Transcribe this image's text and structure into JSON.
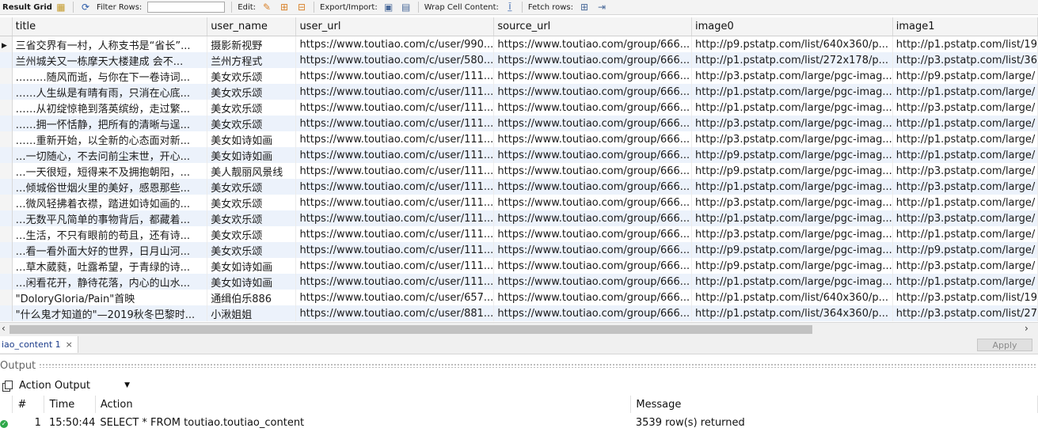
{
  "toolbar": {
    "result_grid": "Result Grid",
    "filter_rows": "Filter Rows:",
    "edit": "Edit:",
    "export_import": "Export/Import:",
    "wrap_cell": "Wrap Cell Content:",
    "fetch_rows": "Fetch rows:"
  },
  "grid": {
    "columns": [
      "title",
      "user_name",
      "user_url",
      "source_url",
      "image0",
      "image1"
    ],
    "rows": [
      [
        "三省交界有一村，人称支书是“省长”...",
        "摄影新视野",
        "https://www.toutiao.com/c/user/990...",
        "https://www.toutiao.com/group/666...",
        "http://p9.pstatp.com/list/640x360/p...",
        "http://p1.pstatp.com/list/19"
      ],
      [
        "兰州城关又一栋摩天大楼建成 会不...",
        "兰州方程式",
        "https://www.toutiao.com/c/user/580...",
        "https://www.toutiao.com/group/666...",
        "http://p1.pstatp.com/list/272x178/p...",
        "http://p3.pstatp.com/list/36"
      ],
      [
        "………随风而逝，与你在下一卷诗词...",
        "美女欢乐颂",
        "https://www.toutiao.com/c/user/111...",
        "https://www.toutiao.com/group/666...",
        "http://p3.pstatp.com/large/pgc-imag...",
        "http://p9.pstatp.com/large/"
      ],
      [
        "……人生纵是有晴有雨，只消在心底...",
        "美女欢乐颂",
        "https://www.toutiao.com/c/user/111...",
        "https://www.toutiao.com/group/666...",
        "http://p1.pstatp.com/large/pgc-imag...",
        "http://p1.pstatp.com/large/"
      ],
      [
        "……从初绽惊艳到落英缤纷，走过繁...",
        "美女欢乐颂",
        "https://www.toutiao.com/c/user/111...",
        "https://www.toutiao.com/group/666...",
        "http://p1.pstatp.com/large/pgc-imag...",
        "http://p3.pstatp.com/large/"
      ],
      [
        "……拥一怀恬静，把所有的清晰与逞...",
        "美女欢乐颂",
        "https://www.toutiao.com/c/user/111...",
        "https://www.toutiao.com/group/666...",
        "http://p3.pstatp.com/large/pgc-imag...",
        "http://p1.pstatp.com/large/"
      ],
      [
        "……重新开始，以全新的心态面对新...",
        "美女如诗如画",
        "https://www.toutiao.com/c/user/111...",
        "https://www.toutiao.com/group/666...",
        "http://p3.pstatp.com/large/pgc-imag...",
        "http://p1.pstatp.com/large/"
      ],
      [
        "…一切随心，不去问前尘末世，开心...",
        "美女如诗如画",
        "https://www.toutiao.com/c/user/111...",
        "https://www.toutiao.com/group/666...",
        "http://p9.pstatp.com/large/pgc-imag...",
        "http://p1.pstatp.com/large/"
      ],
      [
        "…一天很短，短得来不及拥抱朝阳，...",
        "美人靓丽风景线",
        "https://www.toutiao.com/c/user/111...",
        "https://www.toutiao.com/group/666...",
        "http://p9.pstatp.com/large/pgc-imag...",
        "http://p3.pstatp.com/large/"
      ],
      [
        "…倾城俗世烟火里的美好，感恩那些...",
        "美女欢乐颂",
        "https://www.toutiao.com/c/user/111...",
        "https://www.toutiao.com/group/666...",
        "http://p1.pstatp.com/large/pgc-imag...",
        "http://p3.pstatp.com/large/"
      ],
      [
        "…微风轻拂着衣襟，踏进如诗如画的...",
        "美女欢乐颂",
        "https://www.toutiao.com/c/user/111...",
        "https://www.toutiao.com/group/666...",
        "http://p3.pstatp.com/large/pgc-imag...",
        "http://p1.pstatp.com/large/"
      ],
      [
        "…无数平凡简单的事物背后，都藏着...",
        "美女欢乐颂",
        "https://www.toutiao.com/c/user/111...",
        "https://www.toutiao.com/group/666...",
        "http://p1.pstatp.com/large/pgc-imag...",
        "http://p3.pstatp.com/large/"
      ],
      [
        "…生活，不只有眼前的苟且，还有诗...",
        "美女欢乐颂",
        "https://www.toutiao.com/c/user/111...",
        "https://www.toutiao.com/group/666...",
        "http://p3.pstatp.com/large/pgc-imag...",
        "http://p1.pstatp.com/large/"
      ],
      [
        "…看一看外面大好的世界，日月山河...",
        "美女欢乐颂",
        "https://www.toutiao.com/c/user/111...",
        "https://www.toutiao.com/group/666...",
        "http://p9.pstatp.com/large/pgc-imag...",
        "http://p9.pstatp.com/large/"
      ],
      [
        "…草木葳蕤，吐露希望，于青绿的诗...",
        "美女如诗如画",
        "https://www.toutiao.com/c/user/111...",
        "https://www.toutiao.com/group/666...",
        "http://p9.pstatp.com/large/pgc-imag...",
        "http://p3.pstatp.com/large/"
      ],
      [
        "…闲看花开，静待花落，内心的山水...",
        "美女如诗如画",
        "https://www.toutiao.com/c/user/111...",
        "https://www.toutiao.com/group/666...",
        "http://p1.pstatp.com/large/pgc-imag...",
        "http://p1.pstatp.com/large/"
      ],
      [
        "\"DoloryGloria/Pain\"首映",
        "通缉伯乐886",
        "https://www.toutiao.com/c/user/657...",
        "https://www.toutiao.com/group/666...",
        "http://p1.pstatp.com/list/640x360/p...",
        "http://p3.pstatp.com/list/19"
      ],
      [
        "\"什么鬼才知道的\"—2019秋冬巴黎时...",
        "小湫姐姐",
        "https://www.toutiao.com/c/user/881...",
        "https://www.toutiao.com/group/666...",
        "http://p1.pstatp.com/list/364x360/p...",
        "http://p3.pstatp.com/list/27"
      ]
    ]
  },
  "tab": {
    "label": "iao_content 1",
    "close": "×"
  },
  "apply_label": "Apply",
  "output": {
    "header": "Output",
    "selector": "Action Output",
    "columns": [
      "",
      "#",
      "Time",
      "Action",
      "Message"
    ],
    "rows": [
      {
        "num": "1",
        "time": "15:50:44",
        "action": "SELECT * FROM toutiao.toutiao_content",
        "message": "3539 row(s) returned"
      }
    ]
  }
}
